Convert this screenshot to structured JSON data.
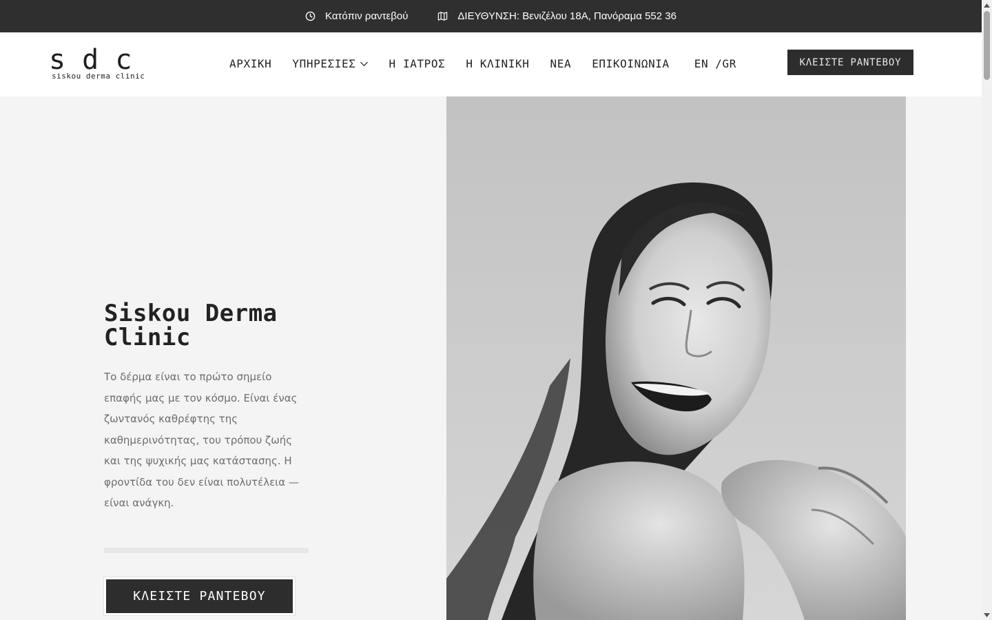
{
  "topbar": {
    "hours_text": "Κατόπιν ραντεβού",
    "address_text": "ΔΙΕΥΘΥΝΣΗ: Βενιζέλου 18Α, Πανόραμα 552 36",
    "hours_icon": "clock-icon",
    "address_icon": "map-icon"
  },
  "header": {
    "logo_mark": "s d c",
    "logo_word": "siskou derma clinic",
    "nav": [
      {
        "label": "ΑΡΧΙΚΗ"
      },
      {
        "label": "ΥΠΗΡΕΣΙΕΣ",
        "icon": "chevron-down-icon"
      },
      {
        "label": "Η ΙΑΤΡΟΣ"
      },
      {
        "label": "Η ΚΛΙΝΙΚΗ"
      },
      {
        "label": "ΝΕΑ"
      },
      {
        "label": "ΕΠΙΚΟΙΝΩΝΙΑ"
      }
    ],
    "lang_en": "EN",
    "lang_gr": "/GR",
    "cta_label": "ΚΛΕΙΣΤΕ ΡΑΝΤΕΒΟΥ"
  },
  "hero": {
    "title": "Siskou Derma Clinic",
    "text": "Το δέρμα είναι το πρώτο σημείο επαφής μας με τον κόσμο. Είναι ένας ζωντανός καθρέφτης της καθημερινότητας, του τρόπου ζωής και της ψυχικής μας κατάστασης. Η φροντίδα του δεν είναι πολυτέλεια — είναι ανάγκη.",
    "cta_label": "ΚΛΕΙΣΤΕ ΡΑΝΤΕΒΟΥ"
  },
  "colors": {
    "topbar_bg": "#2f2f2f",
    "hero_bg": "#f4f4f4",
    "button_bg": "#2d2d2d",
    "text_dark": "#222222",
    "text_muted": "#6d6d6d"
  }
}
